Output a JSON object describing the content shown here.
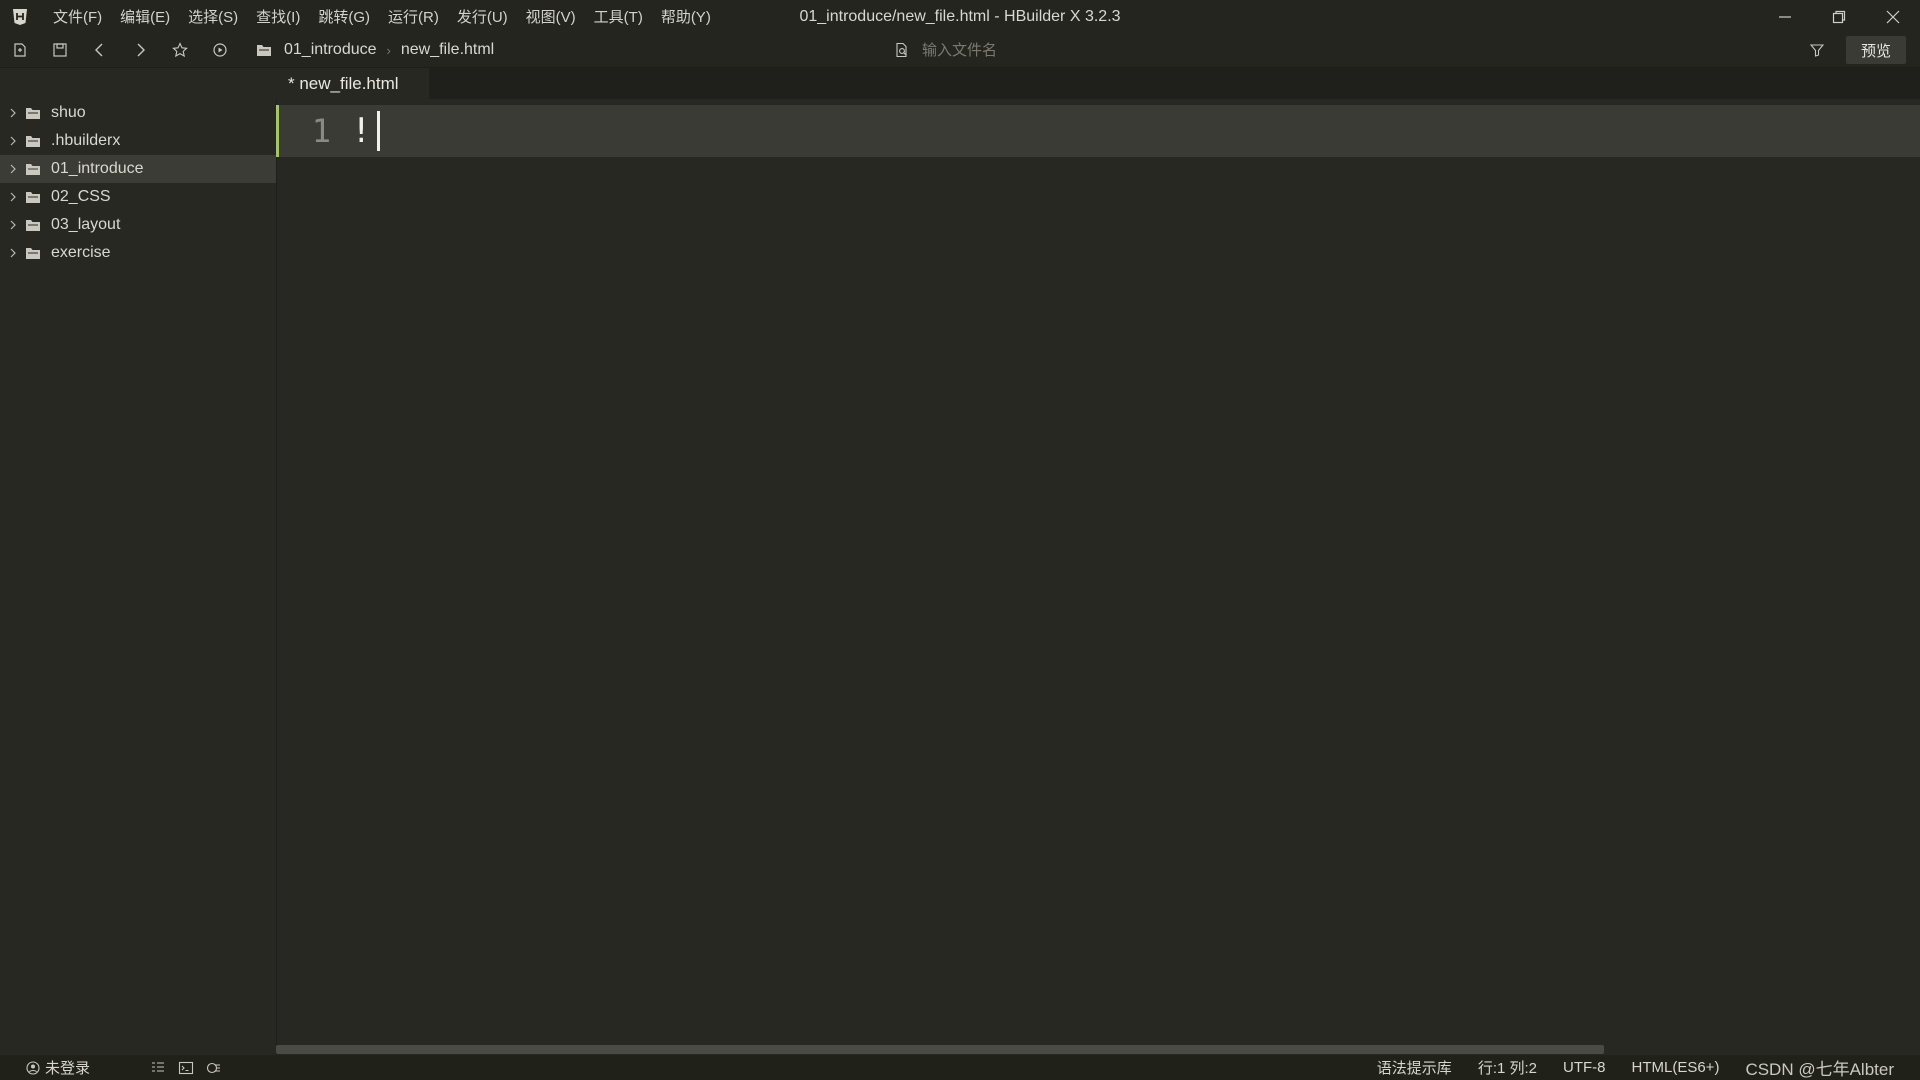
{
  "app": {
    "window_title": "01_introduce/new_file.html - HBuilder X 3.2.3",
    "menu": [
      "文件(F)",
      "编辑(E)",
      "选择(S)",
      "查找(I)",
      "跳转(G)",
      "运行(R)",
      "发行(U)",
      "视图(V)",
      "工具(T)",
      "帮助(Y)"
    ]
  },
  "toolbar": {
    "breadcrumb": [
      "01_introduce",
      "new_file.html"
    ],
    "search_placeholder": "输入文件名",
    "preview_label": "预览"
  },
  "sidebar": {
    "items": [
      {
        "label": "shuo",
        "selected": false
      },
      {
        "label": ".hbuilderx",
        "selected": false
      },
      {
        "label": "01_introduce",
        "selected": true
      },
      {
        "label": "02_CSS",
        "selected": false
      },
      {
        "label": "03_layout",
        "selected": false
      },
      {
        "label": "exercise",
        "selected": false
      }
    ]
  },
  "editor": {
    "tab_label": "* new_file.html",
    "lines": [
      {
        "number": "1",
        "text": "!"
      }
    ]
  },
  "status": {
    "login": "未登录",
    "syntax_lib": "语法提示库",
    "position": "行:1  列:2",
    "encoding": "UTF-8",
    "language": "HTML(ES6+)",
    "watermark": "CSDN @七年Albter"
  },
  "colors": {
    "background": "#272822",
    "accent_line": "#a6c36a",
    "current_line": "#3a3b35"
  }
}
